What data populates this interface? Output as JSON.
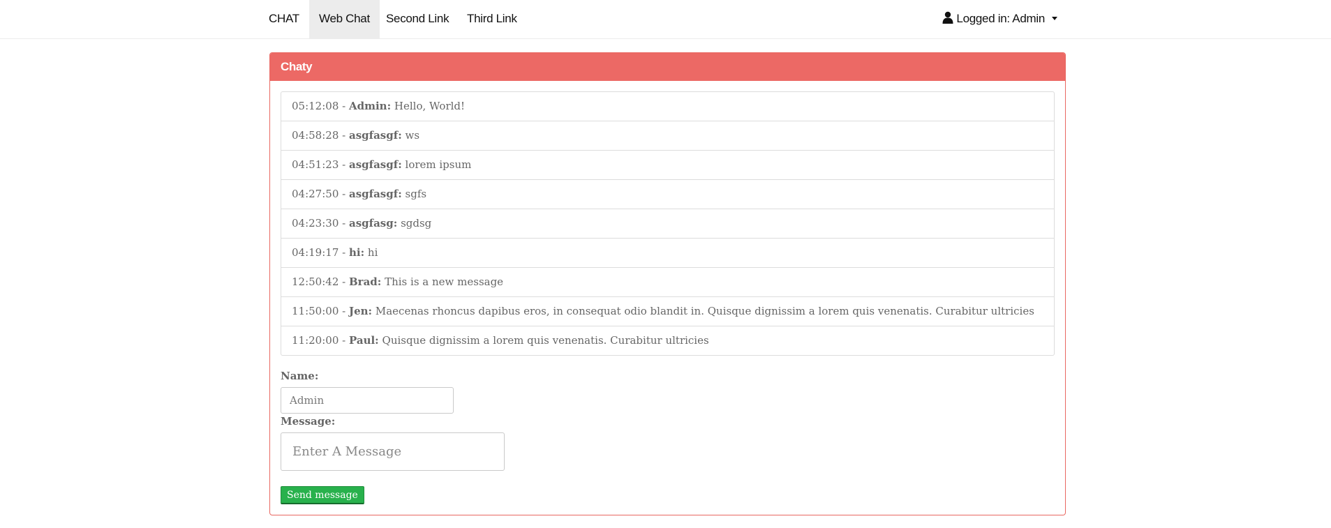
{
  "navbar": {
    "brand": "CHAT",
    "links": [
      {
        "label": "Web Chat",
        "active": true
      },
      {
        "label": "Second Link",
        "active": false
      },
      {
        "label": "Third Link",
        "active": false
      }
    ],
    "user_label": "Logged in: Admin",
    "user_icon": "user-icon",
    "dropdown_icon": "caret-down-icon"
  },
  "panel": {
    "title": "Chaty",
    "accent_color": "#ec6965"
  },
  "messages": [
    {
      "time": "05:12:08",
      "user": "Admin:",
      "text": "Hello, World!"
    },
    {
      "time": "04:58:28",
      "user": "asgfasgf:",
      "text": "ws"
    },
    {
      "time": "04:51:23",
      "user": "asgfasgf:",
      "text": "lorem ipsum"
    },
    {
      "time": "04:27:50",
      "user": "asgfasgf:",
      "text": "sgfs"
    },
    {
      "time": "04:23:30",
      "user": "asgfasg:",
      "text": "sgdsg"
    },
    {
      "time": "04:19:17",
      "user": "hi:",
      "text": "hi"
    },
    {
      "time": "12:50:42",
      "user": "Brad:",
      "text": "This is a new message"
    },
    {
      "time": "11:50:00",
      "user": "Jen:",
      "text": "Maecenas rhoncus dapibus eros, in consequat odio blandit in. Quisque dignissim a lorem quis venenatis. Curabitur ultricies"
    },
    {
      "time": "11:20:00",
      "user": "Paul:",
      "text": "Quisque dignissim a lorem quis venenatis. Curabitur ultricies"
    }
  ],
  "form": {
    "name_label": "Name:",
    "name_value": "Admin",
    "message_label": "Message:",
    "message_placeholder": "Enter A Message",
    "send_label": "Send message",
    "send_color": "#28b14c"
  }
}
